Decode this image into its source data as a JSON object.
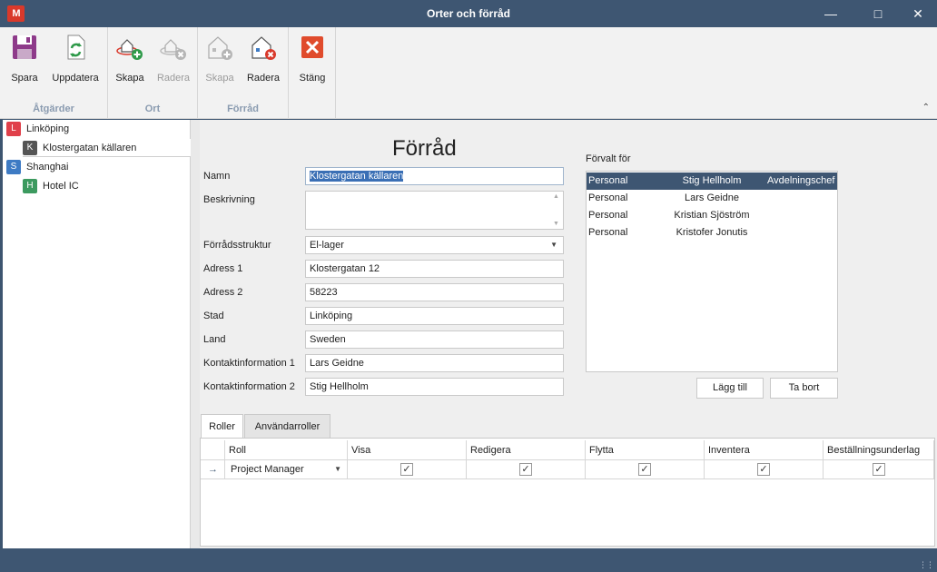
{
  "window": {
    "title": "Orter och förråd",
    "logo_text": "M"
  },
  "ribbon": {
    "groups": [
      {
        "label": "Åtgärder",
        "buttons": [
          {
            "label": "Spara"
          },
          {
            "label": "Uppdatera"
          }
        ]
      },
      {
        "label": "Ort",
        "buttons": [
          {
            "label": "Skapa"
          },
          {
            "label": "Radera"
          }
        ]
      },
      {
        "label": "Förråd",
        "buttons": [
          {
            "label": "Skapa"
          },
          {
            "label": "Radera"
          }
        ]
      },
      {
        "label": "",
        "buttons": [
          {
            "label": "Stäng"
          }
        ]
      }
    ]
  },
  "tree": {
    "nodes": [
      {
        "badge": "L",
        "label": "Linköping",
        "color": "#e0404a"
      },
      {
        "badge": "K",
        "label": "Klostergatan källaren",
        "color": "#555555"
      },
      {
        "badge": "S",
        "label": "Shanghai",
        "color": "#3e7bc4"
      },
      {
        "badge": "H",
        "label": "Hotel IC",
        "color": "#3c9a5f"
      }
    ]
  },
  "form": {
    "title": "Förråd",
    "fields": {
      "namn": {
        "label": "Namn",
        "value": "Klostergatan källaren"
      },
      "beskrivning": {
        "label": "Beskrivning",
        "value": ""
      },
      "forradsstruktur": {
        "label": "Förrådsstruktur",
        "value": "El-lager"
      },
      "adress1": {
        "label": "Adress 1",
        "value": "Klostergatan 12"
      },
      "adress2": {
        "label": "Adress 2",
        "value": "58223"
      },
      "stad": {
        "label": "Stad",
        "value": "Linköping"
      },
      "land": {
        "label": "Land",
        "value": "Sweden"
      },
      "kontakt1": {
        "label": "Kontaktinformation 1",
        "value": "Lars Geidne"
      },
      "kontakt2": {
        "label": "Kontaktinformation 2",
        "value": "Stig Hellholm"
      }
    }
  },
  "forvalt": {
    "label": "Förvalt för",
    "rows": [
      {
        "type": "Personal",
        "name": "Stig Hellholm",
        "role": "Avdelningschef"
      },
      {
        "type": "Personal",
        "name": "Lars Geidne",
        "role": ""
      },
      {
        "type": "Personal",
        "name": "Kristian Sjöström",
        "role": ""
      },
      {
        "type": "Personal",
        "name": "Kristofer Jonutis",
        "role": ""
      }
    ],
    "add_label": "Lägg till",
    "remove_label": "Ta bort"
  },
  "tabs": [
    {
      "label": "Roller"
    },
    {
      "label": "Användarroller"
    }
  ],
  "roles": {
    "headers": {
      "roll": "Roll",
      "visa": "Visa",
      "redigera": "Redigera",
      "flytta": "Flytta",
      "inventera": "Inventera",
      "bestallning": "Beställningsunderlag"
    },
    "row": {
      "roll": "Project Manager",
      "visa": true,
      "redigera": true,
      "flytta": true,
      "inventera": true,
      "bestallning": true
    }
  },
  "colors": {
    "titlebar": "#3e5672",
    "ribbon": "#f2f2f2",
    "accent": "#3a6fb5"
  }
}
